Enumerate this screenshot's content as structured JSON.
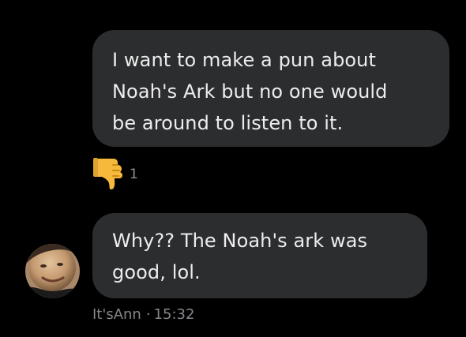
{
  "messages": [
    {
      "text": "I want to make a pun about\nNoah's Ark but no one would\nbe around to listen to it.",
      "reaction": {
        "icon": "thumbs-down-icon",
        "emoji": "👎",
        "count": "1"
      }
    },
    {
      "text": "Why?? The Noah's ark was\ngood, lol.",
      "author": "It'sAnn",
      "separator": "·",
      "time": "15:32",
      "avatar_icon": "user-avatar"
    }
  ],
  "colors": {
    "background": "#000000",
    "bubble": "#2c2d2f",
    "text": "#ededed",
    "meta": "#86868b",
    "thumb": "#f6b93b"
  }
}
